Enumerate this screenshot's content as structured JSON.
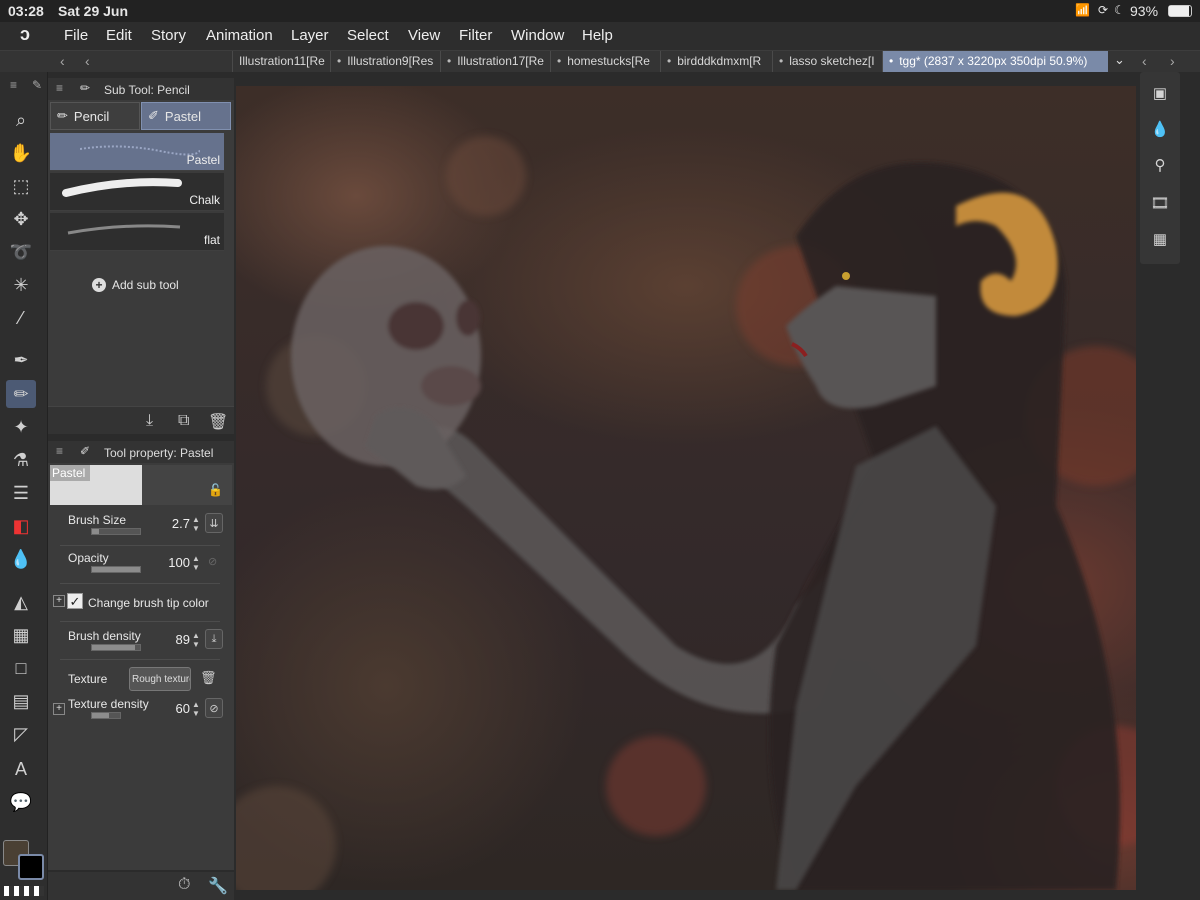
{
  "status": {
    "time": "03:28",
    "date": "Sat 29 Jun",
    "battery": "93%"
  },
  "menu": [
    "File",
    "Edit",
    "Story",
    "Animation",
    "Layer",
    "Select",
    "View",
    "Filter",
    "Window",
    "Help"
  ],
  "tabs": [
    "Illustration11[Re",
    "Illustration9[Res",
    "Illustration17[Re",
    "homestucks[Re",
    "birdddkdmxm[R",
    "lasso sketchez[I",
    "tgg* (2837 x 3220px 350dpi 50.9%)"
  ],
  "subtool": {
    "title": "Sub Tool: Pencil",
    "groups": [
      "Pencil",
      "Pastel"
    ],
    "brushes": [
      "Pastel",
      "Chalk",
      "flat"
    ],
    "add_label": "Add sub tool"
  },
  "property": {
    "title": "Tool property: Pastel",
    "preview_label": "Pastel",
    "brush_size_label": "Brush Size",
    "brush_size": "2.7",
    "brush_size_fill": 0.15,
    "opacity_label": "Opacity",
    "opacity": "100",
    "opacity_fill": 1.0,
    "change_tip_label": "Change brush tip color",
    "brush_density_label": "Brush density",
    "brush_density": "89",
    "brush_density_fill": 0.89,
    "texture_label": "Texture",
    "texture_name": "Rough texture",
    "texture_density_label": "Texture density",
    "texture_density": "60",
    "texture_density_fill": 0.6
  },
  "colors": {
    "main": "#4a4034",
    "sub": "#000000",
    "active_tab": "#7a8aa8",
    "selected": "#66728d"
  }
}
